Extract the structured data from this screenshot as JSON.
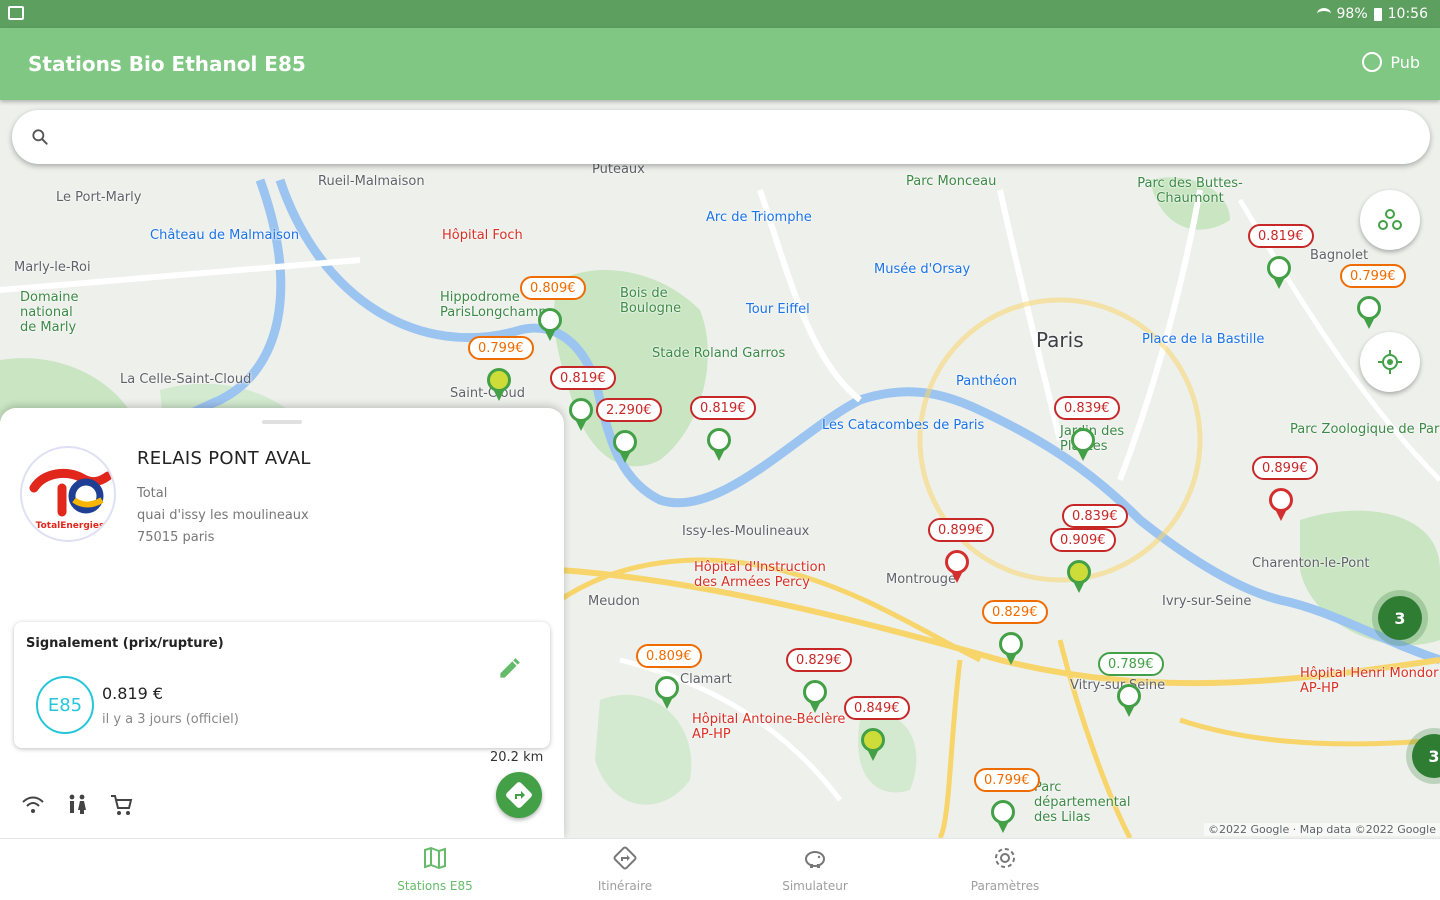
{
  "status_bar": {
    "battery": "98%",
    "time": "10:56"
  },
  "app_bar": {
    "title": "Stations Bio Ethanol E85",
    "pub_label": "Pub"
  },
  "search": {
    "placeholder": ""
  },
  "map": {
    "labels": {
      "le_port_marly": "Le Port-Marly",
      "rueil": "Rueil-Malmaison",
      "puteaux": "Puteaux",
      "parc_monceau": "Parc Monceau",
      "buttes": "Parc des Buttes-Chaumont",
      "chateau": "Château de Malmaison",
      "hopital_foch": "Hôpital Foch",
      "arc": "Arc de Triomphe",
      "marly": "Marly-le-Roi",
      "domaine": "Domaine national de Marly",
      "hippo": "Hippodrome ParisLongchamp",
      "bois": "Bois de Boulogne",
      "musee": "Musée d'Orsay",
      "tour": "Tour Eiffel",
      "paris": "Paris",
      "bastille": "Place de la Bastille",
      "bagnolet": "Bagnolet",
      "stade": "Stade Roland Garros",
      "celle": "La Celle-Saint-Cloud",
      "saint_cloud": "Saint-Cloud",
      "pantheon": "Panthéon",
      "catacombes": "Les Catacombes de Paris",
      "jardin": "Jardin des Plantes",
      "zoo": "Parc Zoologique de Paris",
      "issy": "Issy-les-Moulineaux",
      "hia_percy": "Hôpital d'Instruction des Armées Percy",
      "montrouge": "Montrouge",
      "charenton": "Charenton-le-Pont",
      "meudon": "Meudon",
      "ivry": "Ivry-sur-Seine",
      "vitry": "Vitry-sur-Seine",
      "mondor": "Hôpital Henri Mondor AP-HP",
      "beclere": "Hôpital Antoine-Béclère AP-HP",
      "clamart": "Clamart",
      "lilas": "Parc départemental des Lilas"
    },
    "prices": [
      {
        "label": "0.809€",
        "color": "orange"
      },
      {
        "label": "0.799€",
        "color": "orange"
      },
      {
        "label": "0.819€",
        "color": "red"
      },
      {
        "label": "2.290€",
        "color": "red"
      },
      {
        "label": "0.819€",
        "color": "red"
      },
      {
        "label": "0.819€",
        "color": "red"
      },
      {
        "label": "0.799€",
        "color": "orange"
      },
      {
        "label": "0.839€",
        "color": "red"
      },
      {
        "label": "0.899€",
        "color": "red"
      },
      {
        "label": "0.899€",
        "color": "red"
      },
      {
        "label": "0.839€",
        "color": "red"
      },
      {
        "label": "0.909€",
        "color": "red"
      },
      {
        "label": "0.809€",
        "color": "orange"
      },
      {
        "label": "0.829€",
        "color": "red"
      },
      {
        "label": "0.829€",
        "color": "orange"
      },
      {
        "label": "0.789€",
        "color": "green"
      },
      {
        "label": "0.849€",
        "color": "red"
      },
      {
        "label": "0.799€",
        "color": "orange"
      }
    ],
    "clusters": [
      "3",
      "3"
    ],
    "copyright": "©2022 Google · Map data ©2022 Google"
  },
  "station": {
    "brand_text": "TotalEnergies",
    "name": "RELAIS PONT AVAL",
    "brand": "Total",
    "address1": "quai d'issy les moulineaux",
    "address2": "75015 paris",
    "report_title": "Signalement (prix/rupture)",
    "fuel_type": "E85",
    "price": "0.819 €",
    "updated": "il y a 3 jours (officiel)",
    "distance": "20.2 km"
  },
  "nav": [
    {
      "label": "Stations E85"
    },
    {
      "label": "Itinéraire"
    },
    {
      "label": "Simulateur"
    },
    {
      "label": "Paramètres"
    }
  ],
  "colors": {
    "primary": "#81c784",
    "status": "#5d9f5f",
    "accent": "#43a047",
    "price_red": "#c62828",
    "price_orange": "#ef6c00",
    "e85": "#26c6da"
  }
}
